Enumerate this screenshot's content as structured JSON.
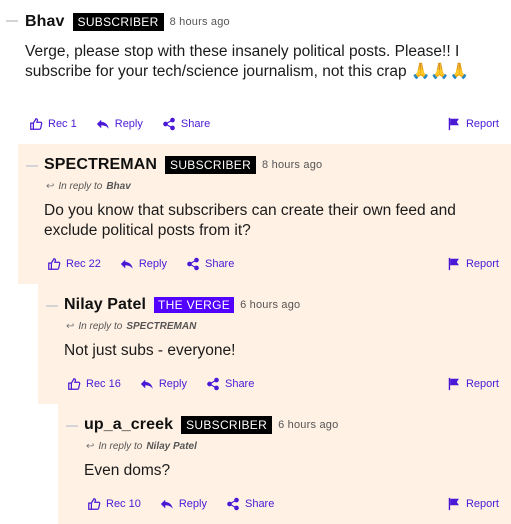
{
  "comments": [
    {
      "author": "Bhav",
      "badge": "SUBSCRIBER",
      "time": "8 hours ago",
      "reply_to_prefix": "",
      "reply_to": "",
      "body": "Verge, please stop with these insanely political posts. Please!! I subscribe for your tech/science journalism, not this crap 🙏🙏🙏",
      "actions": {
        "rec": "Rec 1",
        "reply": "Reply",
        "share": "Share",
        "report": "Report"
      }
    },
    {
      "author": "SPECTREMAN",
      "badge": "SUBSCRIBER",
      "time": "8 hours ago",
      "reply_to_prefix": "In reply to",
      "reply_to": "Bhav",
      "body": "Do you know that subscribers can create their own feed and exclude political posts from it?",
      "actions": {
        "rec": "Rec 22",
        "reply": "Reply",
        "share": "Share",
        "report": "Report"
      }
    },
    {
      "author": "Nilay Patel",
      "badge": "THE VERGE",
      "time": "6 hours ago",
      "reply_to_prefix": "In reply to",
      "reply_to": "SPECTREMAN",
      "body": "Not just subs - everyone!",
      "actions": {
        "rec": "Rec 16",
        "reply": "Reply",
        "share": "Share",
        "report": "Report"
      }
    },
    {
      "author": "up_a_creek",
      "badge": "SUBSCRIBER",
      "time": "6 hours ago",
      "reply_to_prefix": "In reply to",
      "reply_to": "Nilay Patel",
      "body": "Even doms?",
      "actions": {
        "rec": "Rec 10",
        "reply": "Reply",
        "share": "Share",
        "report": "Report"
      }
    }
  ],
  "icons": {
    "rec": "thumbs-up-icon",
    "reply": "reply-arrow-icon",
    "share": "share-icon",
    "report": "flag-icon",
    "reply_to": "reply-arrow-icon"
  },
  "colors": {
    "accent": "#4a19d6",
    "verge_badge": "#5200ff",
    "reply_bg": "#fff1e4"
  }
}
